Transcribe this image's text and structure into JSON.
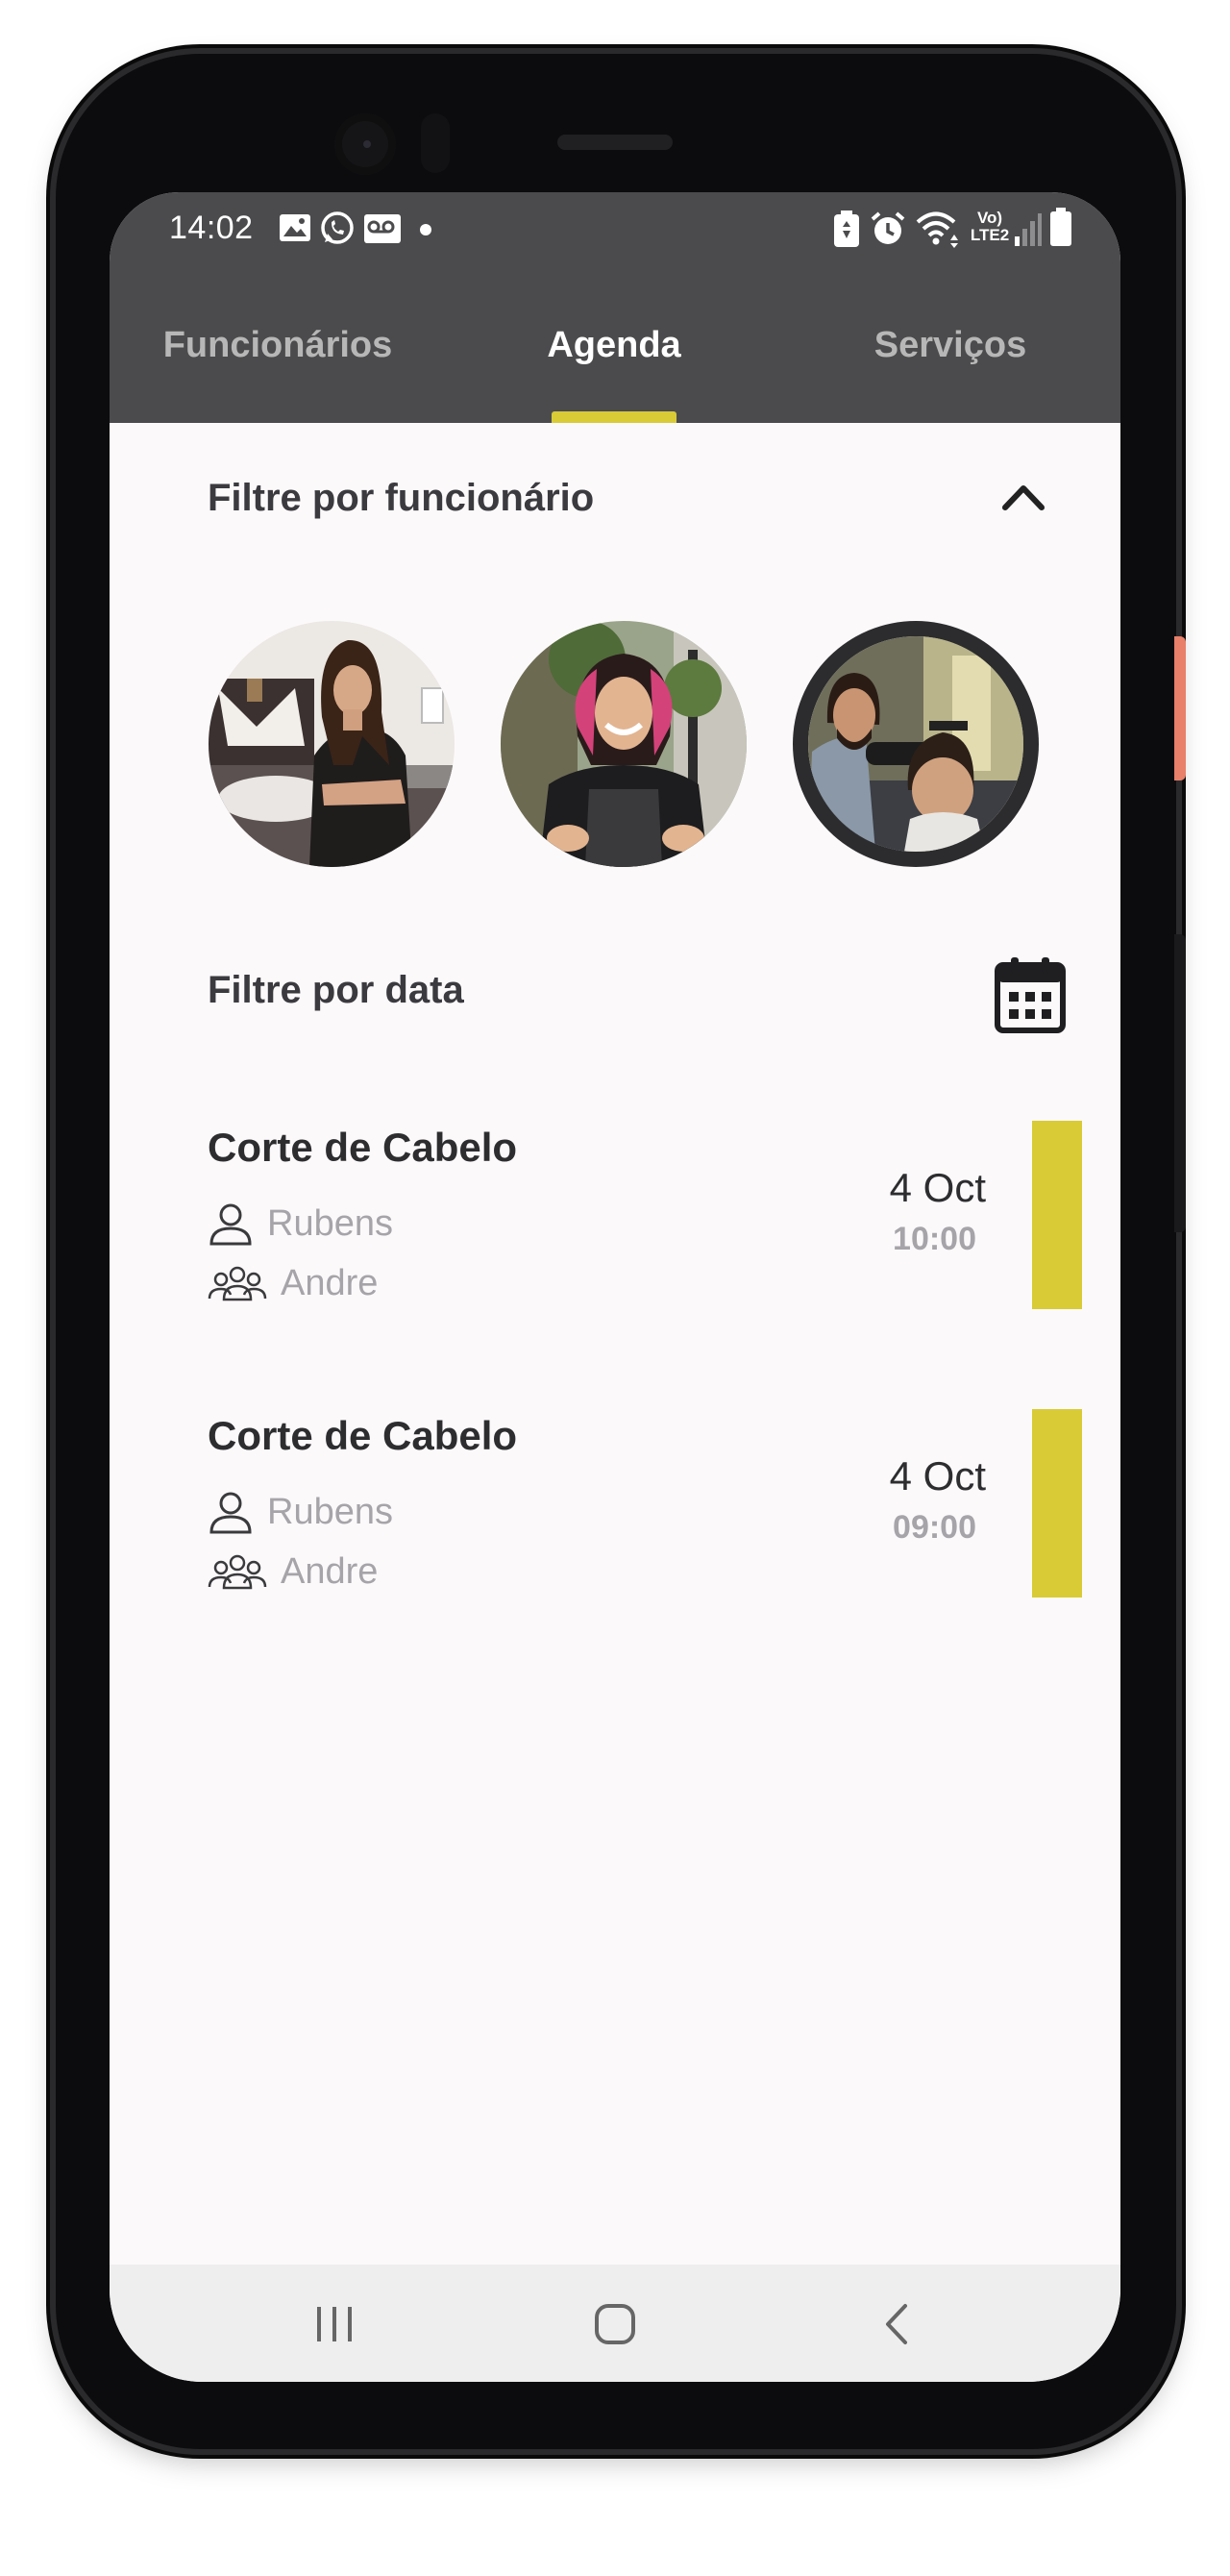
{
  "status_bar": {
    "time": "14:02",
    "network_label_top": "Vo)",
    "network_label_bottom": "LTE2"
  },
  "tabs": [
    {
      "label": "Funcionários",
      "active": false
    },
    {
      "label": "Agenda",
      "active": true
    },
    {
      "label": "Serviços",
      "active": false
    }
  ],
  "filter_employee": {
    "title": "Filtre por funcionário",
    "avatars": [
      {
        "selected": false
      },
      {
        "selected": false
      },
      {
        "selected": true
      }
    ]
  },
  "filter_date": {
    "title": "Filtre por data"
  },
  "appointments": [
    {
      "service": "Corte de Cabelo",
      "client": "Rubens",
      "employee": "Andre",
      "day": "4 Oct",
      "time": "10:00"
    },
    {
      "service": "Corte de Cabelo",
      "client": "Rubens",
      "employee": "Andre",
      "day": "4 Oct",
      "time": "09:00"
    }
  ],
  "colors": {
    "accent": "#d8cb36",
    "appbar": "#4b4b4d",
    "background": "#fcf9fb"
  }
}
